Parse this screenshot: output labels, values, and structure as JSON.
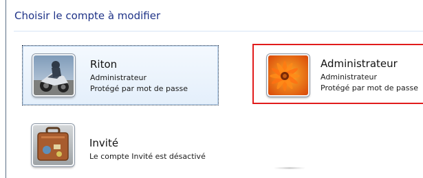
{
  "window": {
    "title": "Choisir le compte à modifier"
  },
  "accounts": [
    {
      "name": "Riton",
      "type": "Administrateur",
      "status": "Protégé par mot de passe",
      "picture": "motorcycle-picture-icon"
    },
    {
      "name": "Administrateur",
      "type": "Administrateur",
      "status": "Protégé par mot de passe",
      "picture": "flower-picture-icon",
      "highlight_color": "#e11b1b"
    },
    {
      "name": "Invité",
      "status": "Le compte Invité est désactivé",
      "picture": "suitcase-picture-icon"
    }
  ],
  "colors": {
    "title": "#1e3287",
    "selection_border": "#1f2f45",
    "selection_fill": "#e4effb",
    "highlight": "#e11b1b"
  }
}
